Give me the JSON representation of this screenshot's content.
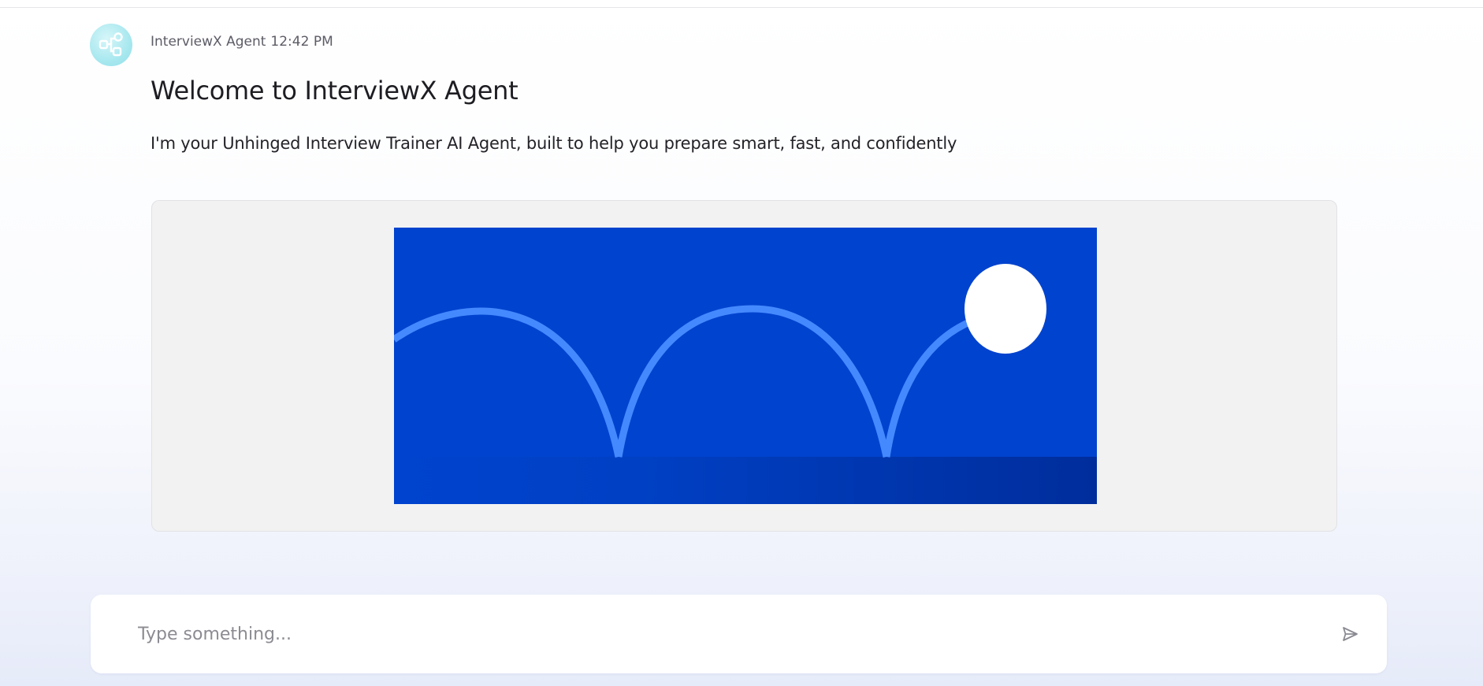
{
  "message": {
    "sender": "InterviewX Agent",
    "time": "12:42 PM",
    "title": "Welcome to InterviewX Agent",
    "body": "I'm your Unhinged Interview Trainer AI Agent, built to help you prepare smart, fast, and confidently"
  },
  "media": {
    "icon": "bouncing-ball-illustration"
  },
  "avatar": {
    "icon": "agent-avatar-icon"
  },
  "composer": {
    "placeholder": "Type something...",
    "value": "",
    "send_icon": "send-icon"
  },
  "colors": {
    "illustration_bg": "#0043ce",
    "arc": "#4589ff",
    "ball": "#ffffff",
    "floor": "#002d9c",
    "avatar_bg": "#a8e8ef"
  }
}
